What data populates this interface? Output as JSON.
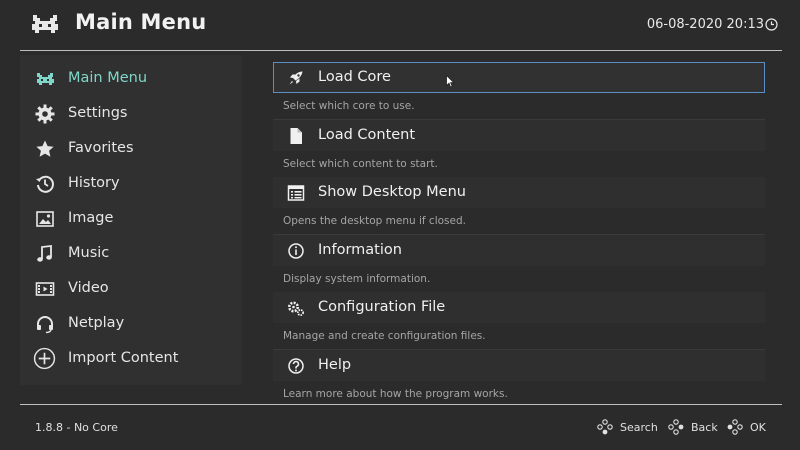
{
  "header": {
    "title": "Main Menu",
    "datetime": "06-08-2020 20:13",
    "logo_icon": "retroarch-invader-icon",
    "clock_icon": "clock-icon"
  },
  "sidebar": {
    "items": [
      {
        "label": "Main Menu",
        "icon": "invader-icon",
        "active": true
      },
      {
        "label": "Settings",
        "icon": "gear-icon"
      },
      {
        "label": "Favorites",
        "icon": "star-icon"
      },
      {
        "label": "History",
        "icon": "history-icon"
      },
      {
        "label": "Image",
        "icon": "image-icon"
      },
      {
        "label": "Music",
        "icon": "music-note-icon"
      },
      {
        "label": "Video",
        "icon": "film-icon"
      },
      {
        "label": "Netplay",
        "icon": "headset-icon"
      },
      {
        "label": "Import Content",
        "icon": "plus-circle-icon"
      }
    ]
  },
  "menu": {
    "entries": [
      {
        "label": "Load Core",
        "desc": "Select which core to use.",
        "icon": "rocket-icon",
        "selected": true
      },
      {
        "label": "Load Content",
        "desc": "Select which content to start.",
        "icon": "file-icon"
      },
      {
        "label": "Show Desktop Menu",
        "desc": "Opens the desktop menu if closed.",
        "icon": "desktop-menu-icon"
      },
      {
        "label": "Information",
        "desc": "Display system information.",
        "icon": "info-icon"
      },
      {
        "label": "Configuration File",
        "desc": "Manage and create configuration files.",
        "icon": "config-gears-icon"
      },
      {
        "label": "Help",
        "desc": "Learn more about how the program works.",
        "icon": "help-icon"
      }
    ]
  },
  "footer": {
    "version": "1.8.8 - No Core",
    "search_label": "Search",
    "back_label": "Back",
    "ok_label": "OK"
  },
  "colors": {
    "background": "#2b2b2b",
    "sidebar": "#303030",
    "accent_active": "#7fd6c8",
    "selection_border": "#5b8ec7"
  }
}
